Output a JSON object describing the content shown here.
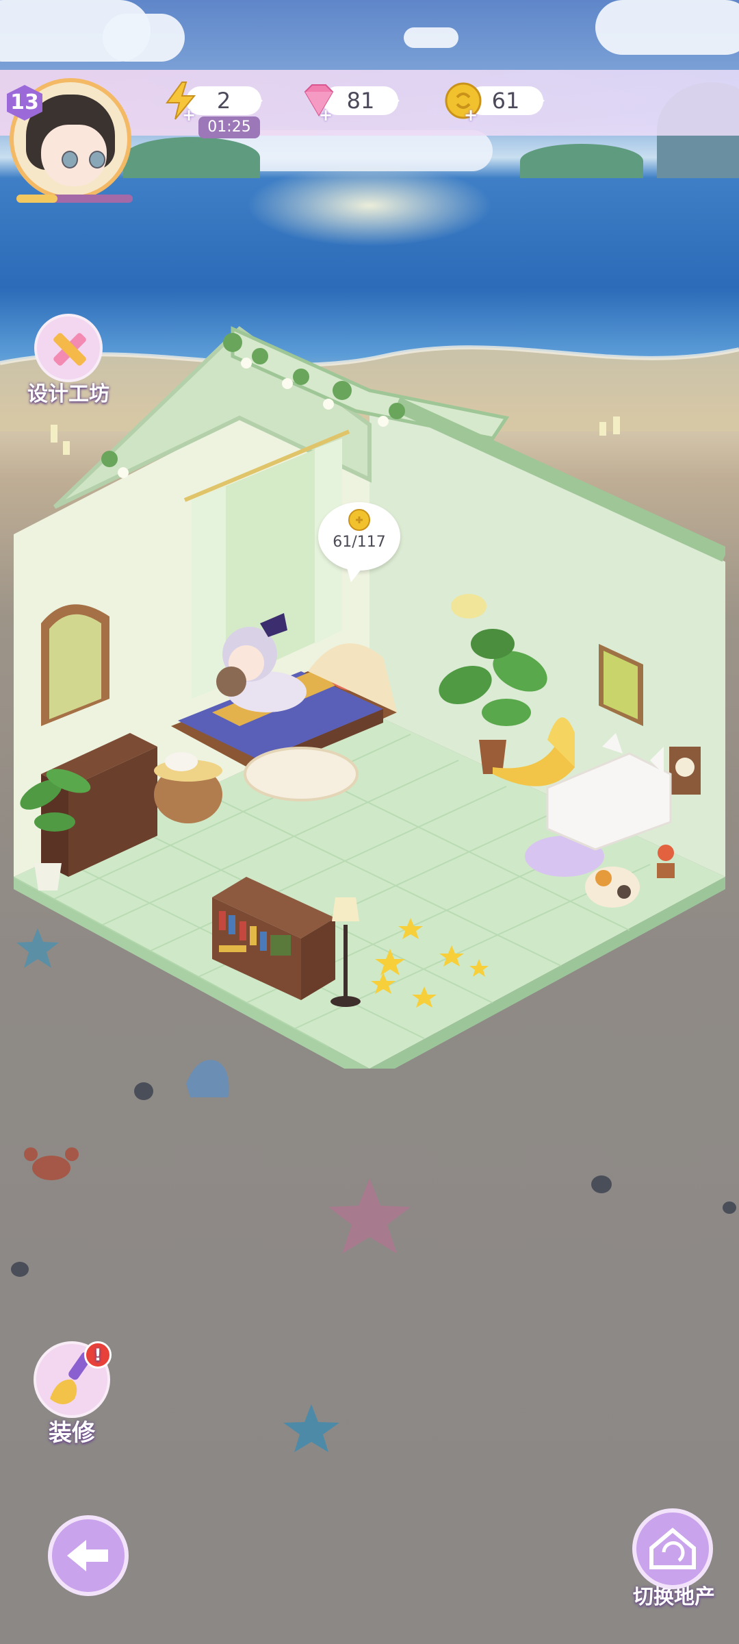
{
  "player": {
    "level": "13",
    "xp_fraction": 0.35
  },
  "resources": {
    "energy": {
      "icon": "lightning-icon",
      "value": "2",
      "timer": "01:25"
    },
    "gems": {
      "icon": "pink-gem-icon",
      "value": "81"
    },
    "coins": {
      "icon": "gold-coin-icon",
      "value": "61"
    }
  },
  "room": {
    "coin_progress": "61/117"
  },
  "buttons": {
    "design_workshop": "设计工坊",
    "decorate": "装修",
    "switch_property": "切换地产"
  },
  "colors": {
    "accent": "#9b6ad8",
    "coin": "#f2c12e",
    "gem": "#f07fb0",
    "wall": "#e3efd9",
    "floor": "#cfe8c8"
  }
}
